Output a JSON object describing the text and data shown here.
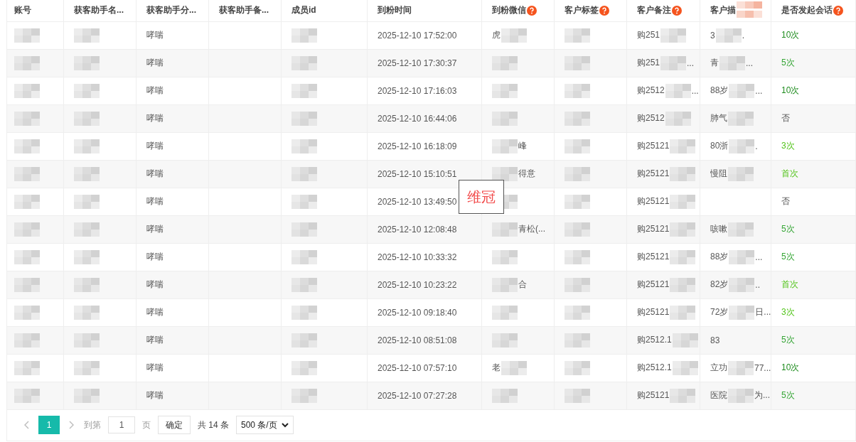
{
  "table": {
    "columns": [
      {
        "label": "账号"
      },
      {
        "label": "获客助手名..."
      },
      {
        "label": "获客助手分..."
      },
      {
        "label": "获客助手备..."
      },
      {
        "label": "成员id"
      },
      {
        "label": "到粉时间"
      },
      {
        "label": "到粉微信",
        "help": true
      },
      {
        "label": "客户标签",
        "help": true
      },
      {
        "label": "客户备注",
        "help": true
      },
      {
        "label": "客户描",
        "redacted": true
      },
      {
        "label": "是否发起会话",
        "help": true
      }
    ],
    "rows": [
      {
        "cells": [
          {
            "redacted": true
          },
          {
            "redacted": true
          },
          {
            "text": "哮喘"
          },
          {},
          {
            "redacted": true
          },
          {
            "text": "2025-12-10 17:52:00"
          },
          {
            "text": "虎",
            "redacted": true
          },
          {
            "redacted": true
          },
          {
            "text": "购251",
            "redacted": true
          },
          {
            "text": "3",
            "redacted": true,
            "after": "."
          },
          {
            "text": "10次",
            "color": "#1e8c1e"
          }
        ]
      },
      {
        "cells": [
          {
            "redacted": true
          },
          {
            "redacted": true
          },
          {
            "text": "哮喘"
          },
          {},
          {
            "redacted": true
          },
          {
            "text": "2025-12-10 17:30:37"
          },
          {
            "redacted": true
          },
          {
            "redacted": true
          },
          {
            "text": "购251",
            "redacted": true,
            "after": "..."
          },
          {
            "text": "青",
            "redacted": true,
            "after": "..."
          },
          {
            "text": "5次",
            "color": "#34a534"
          }
        ]
      },
      {
        "cells": [
          {
            "redacted": true
          },
          {
            "redacted": true
          },
          {
            "text": "哮喘"
          },
          {},
          {
            "redacted": true
          },
          {
            "text": "2025-12-10 17:16:03"
          },
          {
            "redacted": true
          },
          {
            "redacted": true
          },
          {
            "text": "购2512",
            "redacted": true,
            "after": "..."
          },
          {
            "text": "88岁",
            "redacted": true,
            "after": "..."
          },
          {
            "text": "10次",
            "color": "#1e8c1e"
          }
        ]
      },
      {
        "cells": [
          {
            "redacted": true
          },
          {
            "redacted": true
          },
          {
            "text": "哮喘"
          },
          {},
          {
            "redacted": true
          },
          {
            "text": "2025-12-10 16:44:06"
          },
          {
            "redacted": true
          },
          {
            "redacted": true
          },
          {
            "text": "购2512",
            "redacted": true
          },
          {
            "text": "肺气",
            "redacted": true
          },
          {
            "text": "否"
          }
        ]
      },
      {
        "cells": [
          {
            "redacted": true
          },
          {
            "redacted": true
          },
          {
            "text": "哮喘"
          },
          {},
          {
            "redacted": true
          },
          {
            "text": "2025-12-10 16:18:09"
          },
          {
            "redacted": true,
            "after": "峰"
          },
          {
            "redacted": true
          },
          {
            "text": "购25121",
            "redacted": true
          },
          {
            "text": "80浙",
            "redacted": true,
            "after": "."
          },
          {
            "text": "3次",
            "color": "#52c41a"
          }
        ]
      },
      {
        "cells": [
          {
            "redacted": true
          },
          {
            "redacted": true
          },
          {
            "text": "哮喘"
          },
          {},
          {
            "redacted": true
          },
          {
            "text": "2025-12-10 15:10:51"
          },
          {
            "redacted": true,
            "after": "得意"
          },
          {
            "redacted": true
          },
          {
            "text": "购25121",
            "redacted": true
          },
          {
            "text": "慢阻",
            "redacted": true
          },
          {
            "text": "首次",
            "color": "#52c41a"
          }
        ]
      },
      {
        "cells": [
          {
            "redacted": true
          },
          {
            "redacted": true
          },
          {
            "text": "哮喘"
          },
          {},
          {
            "redacted": true
          },
          {
            "text": "2025-12-10 13:49:50"
          },
          {
            "redacted": true
          },
          {
            "redacted": true
          },
          {
            "text": "购25121",
            "redacted": true
          },
          {},
          {
            "text": "否"
          }
        ]
      },
      {
        "cells": [
          {
            "redacted": true
          },
          {
            "redacted": true
          },
          {
            "text": "哮喘"
          },
          {},
          {
            "redacted": true
          },
          {
            "text": "2025-12-10 12:08:48"
          },
          {
            "redacted": true,
            "after": "青松(..."
          },
          {
            "redacted": true
          },
          {
            "text": "购25121",
            "redacted": true
          },
          {
            "text": "咳嗽",
            "redacted": true
          },
          {
            "text": "5次",
            "color": "#34a534"
          }
        ]
      },
      {
        "cells": [
          {
            "redacted": true
          },
          {
            "redacted": true
          },
          {
            "text": "哮喘"
          },
          {},
          {
            "redacted": true
          },
          {
            "text": "2025-12-10 10:33:32"
          },
          {
            "redacted": true
          },
          {
            "redacted": true
          },
          {
            "text": "购25121",
            "redacted": true
          },
          {
            "text": "88岁",
            "redacted": true,
            "after": "..."
          },
          {
            "text": "5次",
            "color": "#34a534"
          }
        ]
      },
      {
        "cells": [
          {
            "redacted": true
          },
          {
            "redacted": true
          },
          {
            "text": "哮喘"
          },
          {},
          {
            "redacted": true
          },
          {
            "text": "2025-12-10 10:23:22"
          },
          {
            "redacted": true,
            "after": "合"
          },
          {
            "redacted": true
          },
          {
            "text": "购25121",
            "redacted": true
          },
          {
            "text": "82岁",
            "redacted": true,
            "after": ".."
          },
          {
            "text": "首次",
            "color": "#52c41a"
          }
        ]
      },
      {
        "cells": [
          {
            "redacted": true
          },
          {
            "redacted": true
          },
          {
            "text": "哮喘"
          },
          {},
          {
            "redacted": true
          },
          {
            "text": "2025-12-10 09:18:40"
          },
          {
            "redacted": true
          },
          {
            "redacted": true
          },
          {
            "text": "购25121",
            "redacted": true
          },
          {
            "text": "72岁",
            "redacted": true,
            "after": "日..."
          },
          {
            "text": "3次",
            "color": "#52c41a"
          }
        ]
      },
      {
        "cells": [
          {
            "redacted": true
          },
          {
            "redacted": true
          },
          {
            "text": "哮喘"
          },
          {},
          {
            "redacted": true
          },
          {
            "text": "2025-12-10 08:51:08"
          },
          {
            "redacted": true
          },
          {
            "redacted": true
          },
          {
            "text": "购2512.1",
            "redacted": true
          },
          {
            "text": "83"
          },
          {
            "text": "5次",
            "color": "#34a534"
          }
        ]
      },
      {
        "cells": [
          {
            "redacted": true
          },
          {
            "redacted": true
          },
          {
            "text": "哮喘"
          },
          {},
          {
            "redacted": true
          },
          {
            "text": "2025-12-10 07:57:10"
          },
          {
            "text": "老",
            "redacted": true
          },
          {
            "redacted": true
          },
          {
            "text": "购2512.1",
            "redacted": true
          },
          {
            "text": "立功",
            "redacted": true,
            "after": "77..."
          },
          {
            "text": "10次",
            "color": "#1e8c1e"
          }
        ]
      },
      {
        "cells": [
          {
            "redacted": true
          },
          {
            "redacted": true
          },
          {
            "text": "哮喘"
          },
          {},
          {
            "redacted": true
          },
          {
            "text": "2025-12-10 07:27:28"
          },
          {
            "redacted": true
          },
          {
            "redacted": true
          },
          {
            "text": "购25121",
            "redacted": true
          },
          {
            "text": "医院",
            "redacted": true,
            "after": "为..."
          },
          {
            "text": "5次",
            "color": "#34a534"
          }
        ]
      }
    ]
  },
  "overlay_label": "维冠",
  "pagination": {
    "prev": {
      "disabled": true
    },
    "pages": [
      {
        "label": "1",
        "selected": true
      }
    ],
    "next": {
      "disabled": true
    },
    "goto_label": "到第",
    "goto_value": "1",
    "goto_unit": "页",
    "confirm": "确定",
    "total": "共 14 条",
    "page_size": "500 条/页"
  }
}
